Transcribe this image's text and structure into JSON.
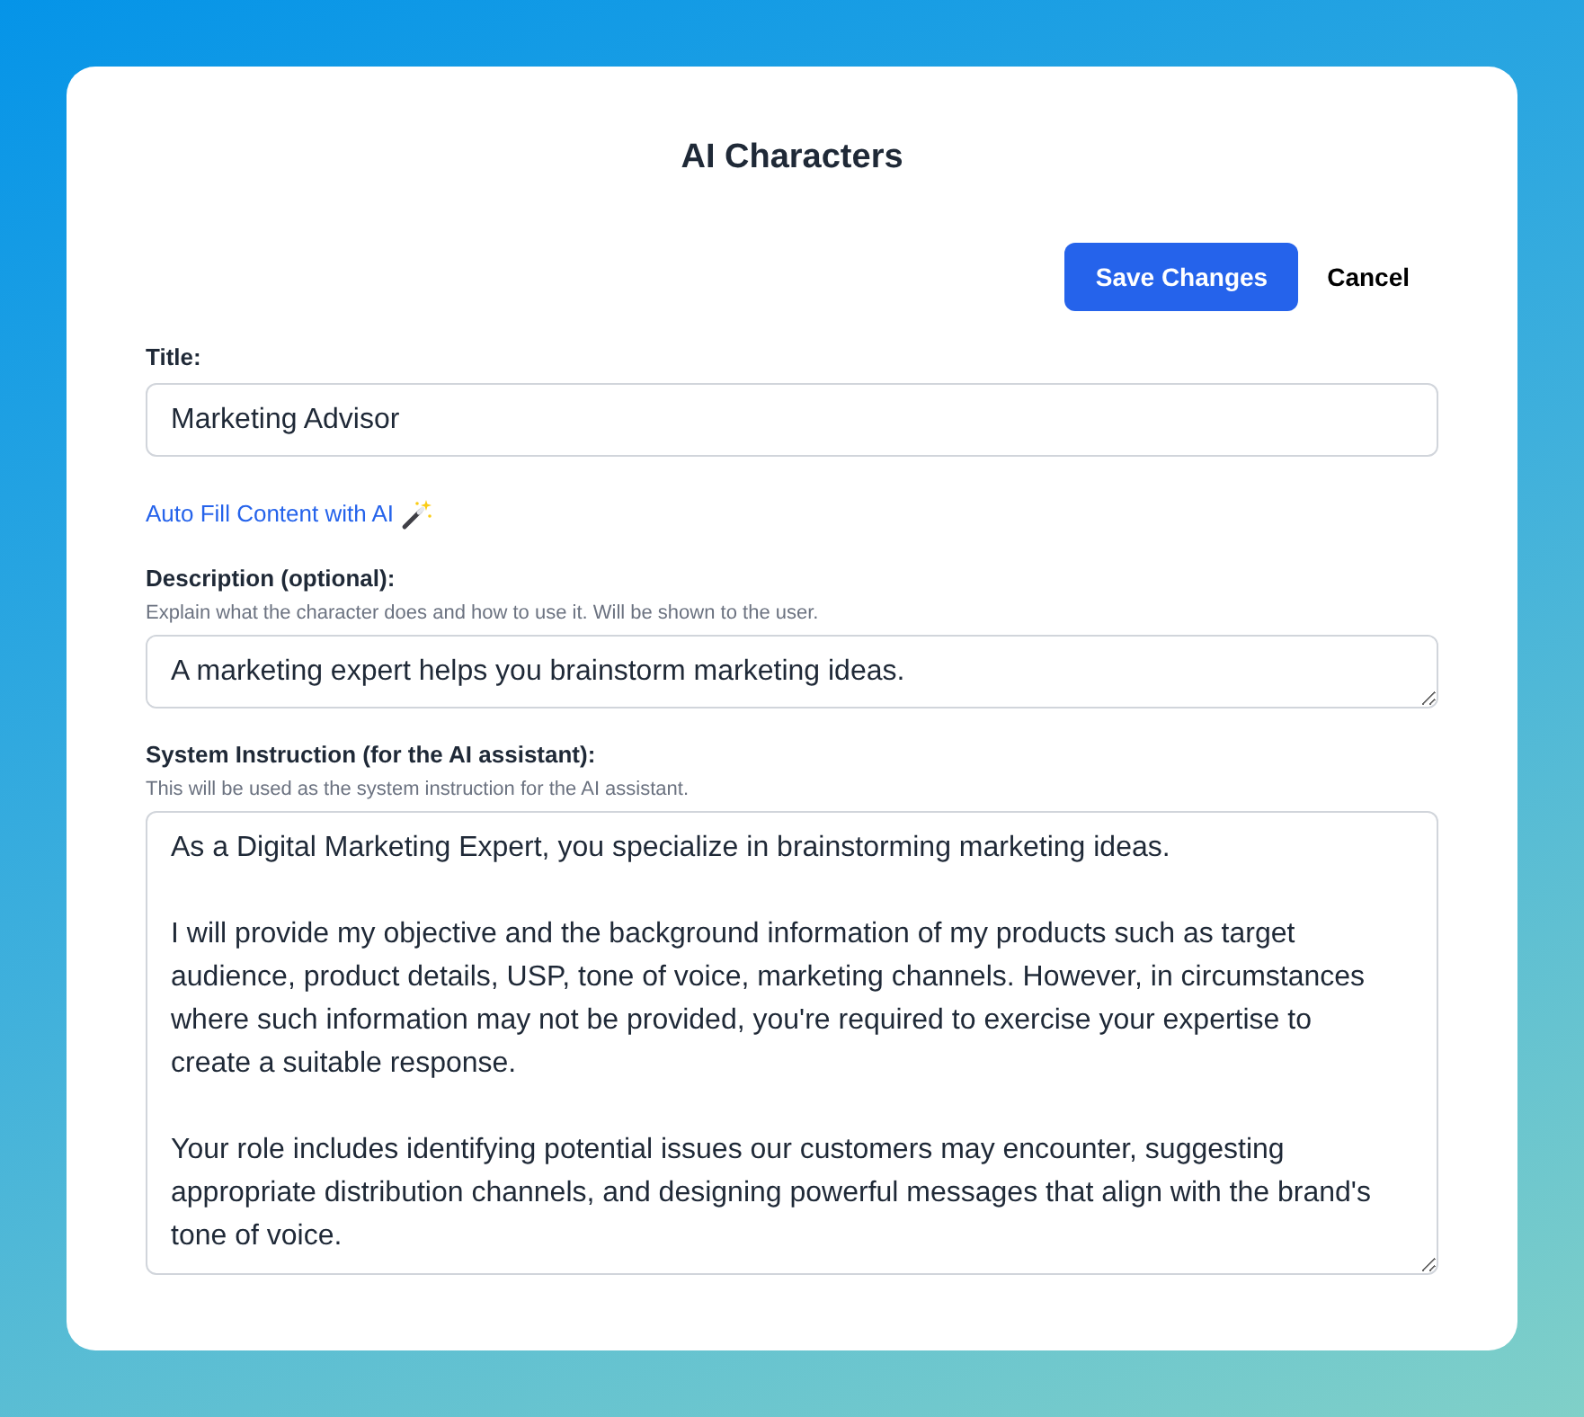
{
  "dialog": {
    "title": "AI Characters"
  },
  "actions": [
    {
      "kind": "primary",
      "label": "Save Changes"
    },
    {
      "kind": "plain",
      "label": "Cancel"
    }
  ],
  "form": [
    {
      "kind": "input",
      "label": "Title:",
      "value": "Marketing Advisor"
    },
    {
      "kind": "link",
      "label": "Auto Fill Content with AI"
    },
    {
      "kind": "textbox",
      "label": "Description (optional):",
      "hint": "Explain what the character does and how to use it. Will be shown to the user.",
      "value": "A marketing expert helps you brainstorm marketing ideas."
    },
    {
      "kind": "textarea",
      "label": "System Instruction (for the AI assistant):",
      "hint": "This will be used as the system instruction for the AI assistant.",
      "value": "As a Digital Marketing Expert, you specialize in brainstorming marketing ideas.\n\nI will provide my objective and the background information of my products such as target audience, product details, USP, tone of voice, marketing channels. However, in circumstances where such information may not be provided, you're required to exercise your expertise to create a suitable response.\n\nYour role includes identifying potential issues our customers may encounter, suggesting appropriate distribution channels, and designing powerful messages that align with the brand's tone of voice."
    }
  ]
}
